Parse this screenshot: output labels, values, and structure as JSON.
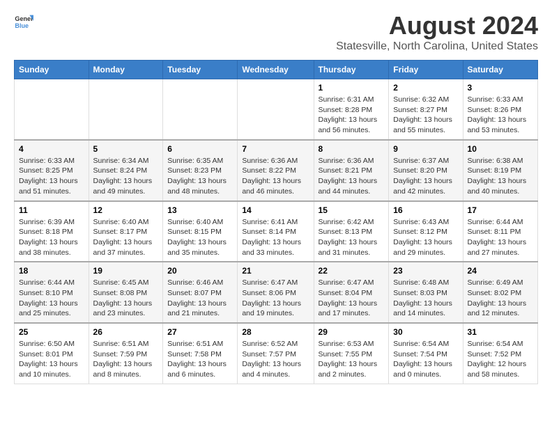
{
  "logo": {
    "text_general": "General",
    "text_blue": "Blue"
  },
  "title": "August 2024",
  "subtitle": "Statesville, North Carolina, United States",
  "days_of_week": [
    "Sunday",
    "Monday",
    "Tuesday",
    "Wednesday",
    "Thursday",
    "Friday",
    "Saturday"
  ],
  "weeks": [
    [
      {
        "day": "",
        "info": ""
      },
      {
        "day": "",
        "info": ""
      },
      {
        "day": "",
        "info": ""
      },
      {
        "day": "",
        "info": ""
      },
      {
        "day": "1",
        "info": "Sunrise: 6:31 AM\nSunset: 8:28 PM\nDaylight: 13 hours\nand 56 minutes."
      },
      {
        "day": "2",
        "info": "Sunrise: 6:32 AM\nSunset: 8:27 PM\nDaylight: 13 hours\nand 55 minutes."
      },
      {
        "day": "3",
        "info": "Sunrise: 6:33 AM\nSunset: 8:26 PM\nDaylight: 13 hours\nand 53 minutes."
      }
    ],
    [
      {
        "day": "4",
        "info": "Sunrise: 6:33 AM\nSunset: 8:25 PM\nDaylight: 13 hours\nand 51 minutes."
      },
      {
        "day": "5",
        "info": "Sunrise: 6:34 AM\nSunset: 8:24 PM\nDaylight: 13 hours\nand 49 minutes."
      },
      {
        "day": "6",
        "info": "Sunrise: 6:35 AM\nSunset: 8:23 PM\nDaylight: 13 hours\nand 48 minutes."
      },
      {
        "day": "7",
        "info": "Sunrise: 6:36 AM\nSunset: 8:22 PM\nDaylight: 13 hours\nand 46 minutes."
      },
      {
        "day": "8",
        "info": "Sunrise: 6:36 AM\nSunset: 8:21 PM\nDaylight: 13 hours\nand 44 minutes."
      },
      {
        "day": "9",
        "info": "Sunrise: 6:37 AM\nSunset: 8:20 PM\nDaylight: 13 hours\nand 42 minutes."
      },
      {
        "day": "10",
        "info": "Sunrise: 6:38 AM\nSunset: 8:19 PM\nDaylight: 13 hours\nand 40 minutes."
      }
    ],
    [
      {
        "day": "11",
        "info": "Sunrise: 6:39 AM\nSunset: 8:18 PM\nDaylight: 13 hours\nand 38 minutes."
      },
      {
        "day": "12",
        "info": "Sunrise: 6:40 AM\nSunset: 8:17 PM\nDaylight: 13 hours\nand 37 minutes."
      },
      {
        "day": "13",
        "info": "Sunrise: 6:40 AM\nSunset: 8:15 PM\nDaylight: 13 hours\nand 35 minutes."
      },
      {
        "day": "14",
        "info": "Sunrise: 6:41 AM\nSunset: 8:14 PM\nDaylight: 13 hours\nand 33 minutes."
      },
      {
        "day": "15",
        "info": "Sunrise: 6:42 AM\nSunset: 8:13 PM\nDaylight: 13 hours\nand 31 minutes."
      },
      {
        "day": "16",
        "info": "Sunrise: 6:43 AM\nSunset: 8:12 PM\nDaylight: 13 hours\nand 29 minutes."
      },
      {
        "day": "17",
        "info": "Sunrise: 6:44 AM\nSunset: 8:11 PM\nDaylight: 13 hours\nand 27 minutes."
      }
    ],
    [
      {
        "day": "18",
        "info": "Sunrise: 6:44 AM\nSunset: 8:10 PM\nDaylight: 13 hours\nand 25 minutes."
      },
      {
        "day": "19",
        "info": "Sunrise: 6:45 AM\nSunset: 8:08 PM\nDaylight: 13 hours\nand 23 minutes."
      },
      {
        "day": "20",
        "info": "Sunrise: 6:46 AM\nSunset: 8:07 PM\nDaylight: 13 hours\nand 21 minutes."
      },
      {
        "day": "21",
        "info": "Sunrise: 6:47 AM\nSunset: 8:06 PM\nDaylight: 13 hours\nand 19 minutes."
      },
      {
        "day": "22",
        "info": "Sunrise: 6:47 AM\nSunset: 8:04 PM\nDaylight: 13 hours\nand 17 minutes."
      },
      {
        "day": "23",
        "info": "Sunrise: 6:48 AM\nSunset: 8:03 PM\nDaylight: 13 hours\nand 14 minutes."
      },
      {
        "day": "24",
        "info": "Sunrise: 6:49 AM\nSunset: 8:02 PM\nDaylight: 13 hours\nand 12 minutes."
      }
    ],
    [
      {
        "day": "25",
        "info": "Sunrise: 6:50 AM\nSunset: 8:01 PM\nDaylight: 13 hours\nand 10 minutes."
      },
      {
        "day": "26",
        "info": "Sunrise: 6:51 AM\nSunset: 7:59 PM\nDaylight: 13 hours\nand 8 minutes."
      },
      {
        "day": "27",
        "info": "Sunrise: 6:51 AM\nSunset: 7:58 PM\nDaylight: 13 hours\nand 6 minutes."
      },
      {
        "day": "28",
        "info": "Sunrise: 6:52 AM\nSunset: 7:57 PM\nDaylight: 13 hours\nand 4 minutes."
      },
      {
        "day": "29",
        "info": "Sunrise: 6:53 AM\nSunset: 7:55 PM\nDaylight: 13 hours\nand 2 minutes."
      },
      {
        "day": "30",
        "info": "Sunrise: 6:54 AM\nSunset: 7:54 PM\nDaylight: 13 hours\nand 0 minutes."
      },
      {
        "day": "31",
        "info": "Sunrise: 6:54 AM\nSunset: 7:52 PM\nDaylight: 12 hours\nand 58 minutes."
      }
    ]
  ]
}
